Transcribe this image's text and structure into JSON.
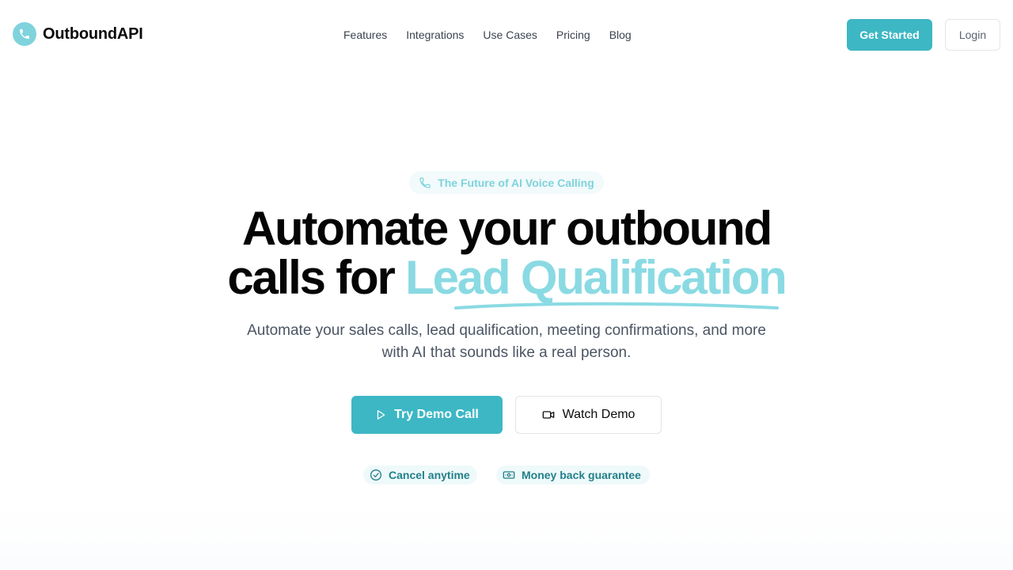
{
  "brand": {
    "name": "OutboundAPI",
    "logo_icon": "phone-icon",
    "logo_color": "#7fd3dc"
  },
  "nav": {
    "items": [
      {
        "label": "Features"
      },
      {
        "label": "Integrations"
      },
      {
        "label": "Use Cases"
      },
      {
        "label": "Pricing"
      },
      {
        "label": "Blog"
      }
    ]
  },
  "header_actions": {
    "get_started": "Get Started",
    "login": "Login"
  },
  "hero": {
    "pill_text": "The Future of AI Voice Calling",
    "pill_icon": "phone-icon",
    "headline_line1": "Automate your outbound",
    "headline_prefix": "calls for",
    "headline_accent": "Lead Qualification",
    "subtitle": "Automate your sales calls, lead qualification, meeting confirmations, and more with AI that sounds like a real person.",
    "primary_cta": "Try Demo Call",
    "primary_cta_icon": "play-icon",
    "secondary_cta": "Watch Demo",
    "secondary_cta_icon": "video-icon",
    "badges": [
      {
        "label": "Cancel anytime",
        "icon": "check-circle-icon"
      },
      {
        "label": "Money back guarantee",
        "icon": "banknote-icon"
      }
    ]
  },
  "colors": {
    "accent": "#3db7c4",
    "accent_light": "#8adae3",
    "text_muted": "#4b5563"
  }
}
